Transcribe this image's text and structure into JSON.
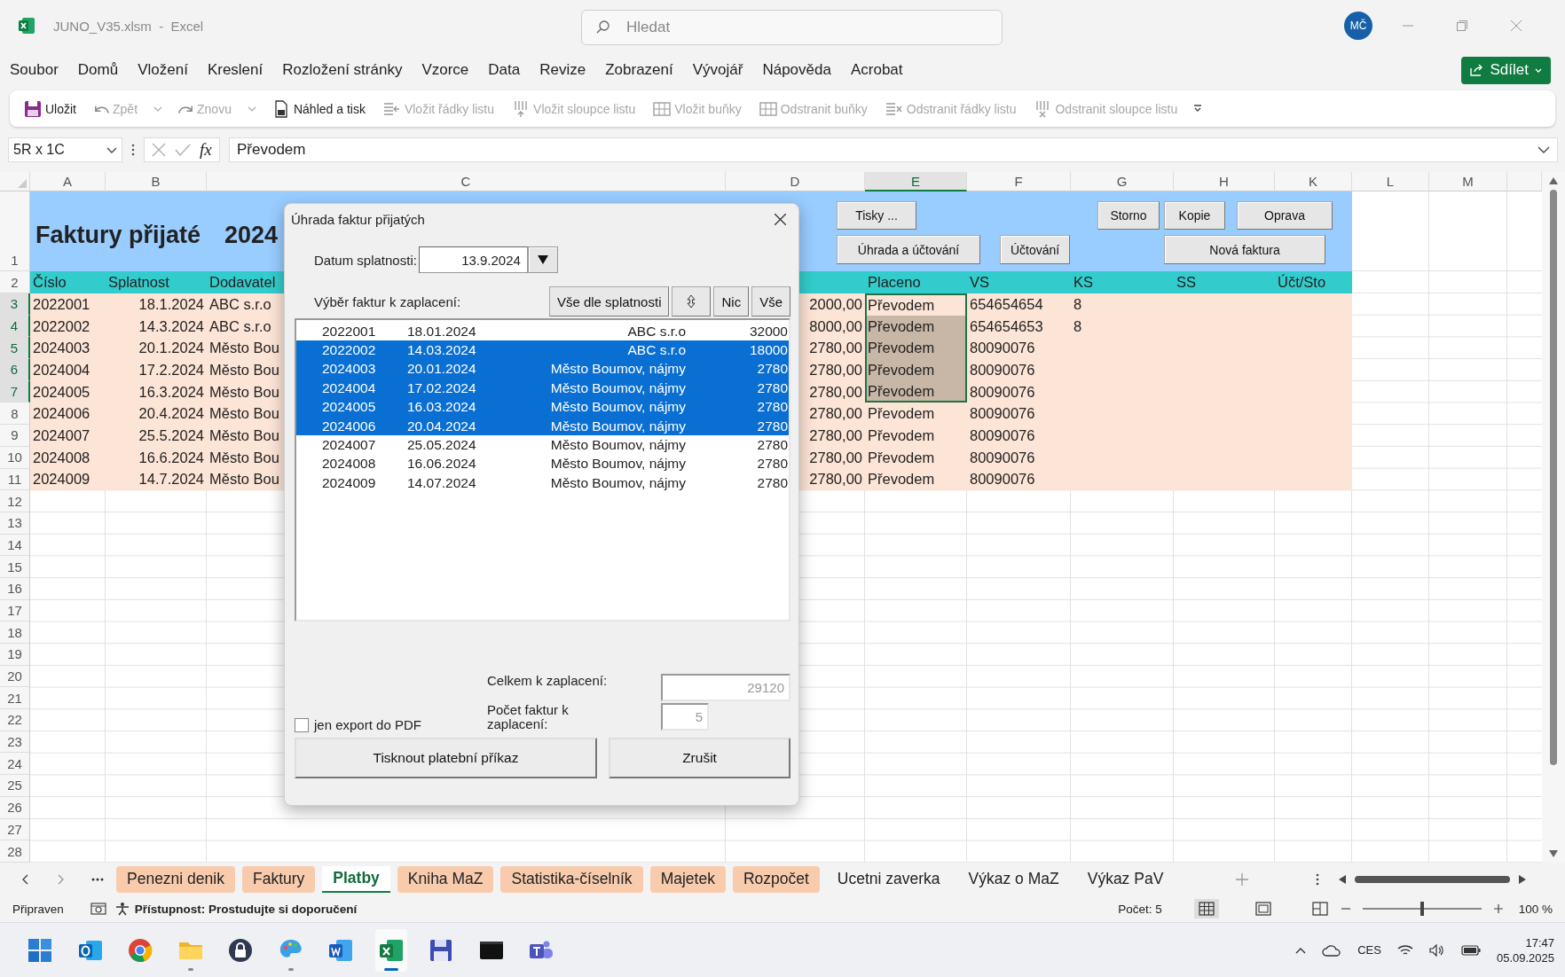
{
  "title_bar": {
    "file_title": "JUNO_V35.xlsm  -  Excel",
    "search": {
      "placeholder": "Hledat"
    },
    "account_initials": "MČ"
  },
  "menu": [
    "Soubor",
    "Domů",
    "Vložení",
    "Kreslení",
    "Rozložení stránky",
    "Vzorce",
    "Data",
    "Revize",
    "Zobrazení",
    "Vývojář",
    "Nápověda",
    "Acrobat"
  ],
  "share_button": "Sdílet",
  "quick_toolbar": [
    {
      "kind": "save",
      "label": "Uložit",
      "disabled": false
    },
    {
      "kind": "undo",
      "label": "Zpět",
      "disabled": true
    },
    {
      "kind": "caret",
      "disabled": true
    },
    {
      "kind": "redo",
      "label": "Znovu",
      "disabled": true
    },
    {
      "kind": "caret",
      "disabled": true
    },
    {
      "kind": "preview",
      "label": "Náhled a tisk",
      "disabled": false
    },
    {
      "kind": "insert_rows",
      "label": "Vložit řádky listu",
      "disabled": true
    },
    {
      "kind": "insert_cols",
      "label": "Vložit sloupce listu",
      "disabled": true
    },
    {
      "kind": "insert_cells",
      "label": "Vložit buňky",
      "disabled": true
    },
    {
      "kind": "delete_cells",
      "label": "Odstranit buňky",
      "disabled": true
    },
    {
      "kind": "delete_rows",
      "label": "Odstranit řádky listu",
      "disabled": true
    },
    {
      "kind": "delete_cols",
      "label": "Odstranit sloupce listu",
      "disabled": true
    },
    {
      "kind": "more",
      "disabled": false
    }
  ],
  "formula_bar": {
    "name_box": "5R x 1C",
    "function_label": "fx",
    "formula": "Převodem"
  },
  "sheet": {
    "columns": [
      {
        "label": "A",
        "selected": false
      },
      {
        "label": "B",
        "selected": false
      },
      {
        "label": "C",
        "selected": false
      },
      {
        "label": "D",
        "selected": false
      },
      {
        "label": "E",
        "selected": true
      },
      {
        "label": "F",
        "selected": false
      },
      {
        "label": "G",
        "selected": false
      },
      {
        "label": "H",
        "selected": false
      },
      {
        "label": "K",
        "selected": false
      },
      {
        "label": "L",
        "selected": false
      },
      {
        "label": "M",
        "selected": false
      }
    ],
    "title_row": {
      "row": "1",
      "title": "Faktury přijaté",
      "year": "2024",
      "buttons": [
        "Tisky ...",
        "Storno",
        "Kopie",
        "Oprava",
        "Úhrada a účtování",
        "Účtování",
        "Nová faktura"
      ]
    },
    "header_row": {
      "row": "2",
      "cislo": "Číslo",
      "splatnost": "Splatnost",
      "dodavatel": "Dodavatel",
      "placeno": "Placeno",
      "vs": "VS",
      "ks": "KS",
      "ss": "SS",
      "uct_sto": "Účt/Sto"
    },
    "rows": [
      {
        "row": "3",
        "cislo": "2022001",
        "splatnost": "18.1.2024",
        "dodavatel": "ABC s.r.o",
        "castka": "2000,00",
        "placeno": "Převodem",
        "vs": "654654654",
        "ks": "8",
        "selected": true,
        "active": true
      },
      {
        "row": "4",
        "cislo": "2022002",
        "splatnost": "14.3.2024",
        "dodavatel": "ABC s.r.o",
        "castka": "8000,00",
        "placeno": "Převodem",
        "vs": "654654653",
        "ks": "8",
        "selected": true,
        "active": false
      },
      {
        "row": "5",
        "cislo": "2024003",
        "splatnost": "20.1.2024",
        "dodavatel": "Město Bou",
        "castka": "2780,00",
        "placeno": "Převodem",
        "vs": "80090076",
        "selected": true,
        "active": false
      },
      {
        "row": "6",
        "cislo": "2024004",
        "splatnost": "17.2.2024",
        "dodavatel": "Město Bou",
        "castka": "2780,00",
        "placeno": "Převodem",
        "vs": "80090076",
        "selected": true,
        "active": false
      },
      {
        "row": "7",
        "cislo": "2024005",
        "splatnost": "16.3.2024",
        "dodavatel": "Město Bou",
        "castka": "2780,00",
        "placeno": "Převodem",
        "vs": "80090076",
        "selected": true,
        "active": false
      },
      {
        "row": "8",
        "cislo": "2024006",
        "splatnost": "20.4.2024",
        "dodavatel": "Město Bou",
        "castka": "2780,00",
        "placeno": "Převodem",
        "vs": "80090076",
        "selected": false,
        "active": false
      },
      {
        "row": "9",
        "cislo": "2024007",
        "splatnost": "25.5.2024",
        "dodavatel": "Město Bou",
        "castka": "2780,00",
        "placeno": "Převodem",
        "vs": "80090076",
        "selected": false,
        "active": false
      },
      {
        "row": "10",
        "cislo": "2024008",
        "splatnost": "16.6.2024",
        "dodavatel": "Město Bou",
        "castka": "2780,00",
        "placeno": "Převodem",
        "vs": "80090076",
        "selected": false,
        "active": false
      },
      {
        "row": "11",
        "cislo": "2024009",
        "splatnost": "14.7.2024",
        "dodavatel": "Město Bou",
        "castka": "2780,00",
        "placeno": "Převodem",
        "vs": "80090076",
        "selected": false,
        "active": false
      }
    ],
    "empty_rows": [
      "12",
      "13",
      "14",
      "15",
      "16",
      "17",
      "18",
      "19",
      "20",
      "21",
      "22",
      "23",
      "24",
      "25",
      "26",
      "27",
      "28"
    ]
  },
  "dialog": {
    "title": "Úhrada faktur přijatých",
    "due_date_label": "Datum splatnosti:",
    "due_date": "13.9.2024",
    "selection_label": "Výběr faktur k zaplacení:",
    "select_buttons": [
      {
        "kind": "text",
        "label": "Vše dle splatnosti"
      },
      {
        "kind": "sort"
      },
      {
        "kind": "text",
        "label": "Nic"
      },
      {
        "kind": "text",
        "label": "Vše"
      }
    ],
    "invoices": [
      {
        "number": "2022001",
        "date": "18.01.2024",
        "supplier": "ABC s.r.o",
        "amount": "32000",
        "selected": false
      },
      {
        "number": "2022002",
        "date": "14.03.2024",
        "supplier": "ABC s.r.o",
        "amount": "18000",
        "selected": true
      },
      {
        "number": "2024003",
        "date": "20.01.2024",
        "supplier": "Město Boumov, nájmy",
        "amount": "2780",
        "selected": true
      },
      {
        "number": "2024004",
        "date": "17.02.2024",
        "supplier": "Město Boumov, nájmy",
        "amount": "2780",
        "selected": true
      },
      {
        "number": "2024005",
        "date": "16.03.2024",
        "supplier": "Město Boumov, nájmy",
        "amount": "2780",
        "selected": true
      },
      {
        "number": "2024006",
        "date": "20.04.2024",
        "supplier": "Město Boumov, nájmy",
        "amount": "2780",
        "selected": true
      },
      {
        "number": "2024007",
        "date": "25.05.2024",
        "supplier": "Město Boumov, nájmy",
        "amount": "2780",
        "selected": false
      },
      {
        "number": "2024008",
        "date": "16.06.2024",
        "supplier": "Město Boumov, nájmy",
        "amount": "2780",
        "selected": false
      },
      {
        "number": "2024009",
        "date": "14.07.2024",
        "supplier": "Město Boumov, nájmy",
        "amount": "2780",
        "selected": false
      }
    ],
    "total_label": "Celkem k zaplacení:",
    "total": "29120",
    "count_label": "Počet faktur k zaplacení:",
    "count": "5",
    "pdf_export": {
      "label": "jen export do PDF",
      "checked": false
    },
    "print_button": "Tisknout platební příkaz",
    "cancel_button": "Zrušit"
  },
  "sheet_tabs": [
    {
      "label": "Penezni denik",
      "selected": false,
      "color": "#f8cbad"
    },
    {
      "label": "Faktury",
      "selected": false,
      "color": "#f8cbad"
    },
    {
      "label": "Platby",
      "selected": true
    },
    {
      "label": "Kniha MaZ",
      "selected": false,
      "color": "#f8cbad"
    },
    {
      "label": "Statistika-číselník",
      "selected": false,
      "color": "#f8cbad"
    },
    {
      "label": "Majetek",
      "selected": false,
      "color": "#f8cbad"
    },
    {
      "label": "Rozpočet",
      "selected": false,
      "color": "#f8cbad"
    },
    {
      "label": "Ucetni zaverka",
      "selected": false
    },
    {
      "label": "Výkaz o MaZ",
      "selected": false
    },
    {
      "label": "Výkaz PaV",
      "selected": false
    }
  ],
  "status_bar": {
    "status": "Připraven",
    "accessibility": "Přístupnost: Prostudujte si doporučení",
    "count": "Počet: 5",
    "zoom": {
      "level": 0.5
    },
    "zoom_label": "100 %"
  },
  "taskbar": {
    "apps": [
      {
        "kind": "start",
        "running": false,
        "active": false
      },
      {
        "kind": "mail",
        "running": false,
        "active": false
      },
      {
        "kind": "browser",
        "running": false,
        "active": false
      },
      {
        "kind": "folder",
        "running": true,
        "active": false
      },
      {
        "kind": "lock",
        "running": false,
        "active": false
      },
      {
        "kind": "palette",
        "running": true,
        "active": false
      },
      {
        "kind": "document",
        "running": false,
        "active": false
      },
      {
        "kind": "spreadsheet",
        "running": true,
        "active": true
      },
      {
        "kind": "floppy",
        "running": false,
        "active": false
      },
      {
        "kind": "terminal",
        "running": false,
        "active": false
      },
      {
        "kind": "people",
        "running": false,
        "active": false
      }
    ],
    "language": "CES",
    "time": "17:47",
    "date": "05.09.2025"
  }
}
